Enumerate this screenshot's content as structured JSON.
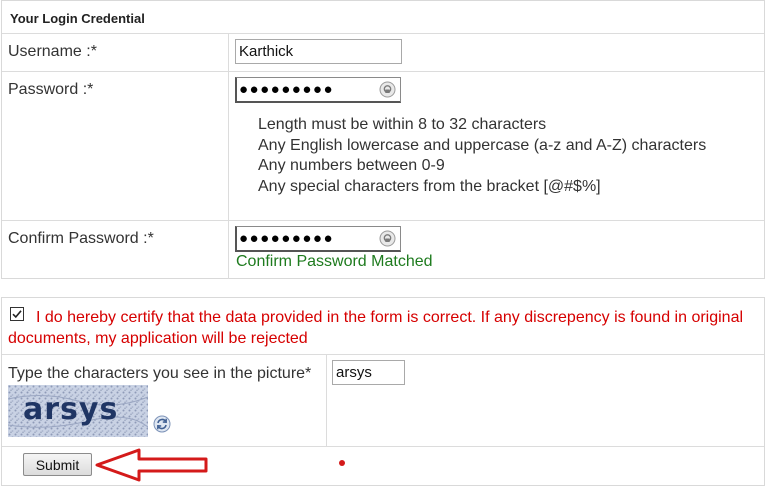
{
  "credentials": {
    "title": "Your Login Credential",
    "username": {
      "label": "Username :*",
      "value": "Karthick"
    },
    "password": {
      "label": "Password :*",
      "masked_value": "●●●●●●●●●",
      "rules": [
        "Length must be within 8 to 32 characters",
        "Any English lowercase and uppercase (a-z and A-Z) characters",
        "Any numbers between 0-9",
        "Any special characters from the bracket [@#$%]"
      ]
    },
    "confirm_password": {
      "label": "Confirm Password :*",
      "masked_value": "●●●●●●●●●",
      "status": "Confirm Password Matched"
    }
  },
  "certification": {
    "checked": true,
    "text": "I do hereby certify that the data provided in the form is correct. If any discrepency is found in original documents, my application will be rejected"
  },
  "captcha": {
    "label": "Type the characters you see in the picture*",
    "image_text": "arsys",
    "value": "arsys"
  },
  "submit_label": "Submit",
  "colors": {
    "success": "#1e7b1e",
    "warning": "#d60000",
    "annotation": "#d41a1a"
  },
  "icons": {
    "password_reveal": "eye-icon",
    "captcha_refresh": "refresh-icon",
    "checkbox": "checkbox-checked-icon",
    "annotation": "arrow-left-icon"
  }
}
